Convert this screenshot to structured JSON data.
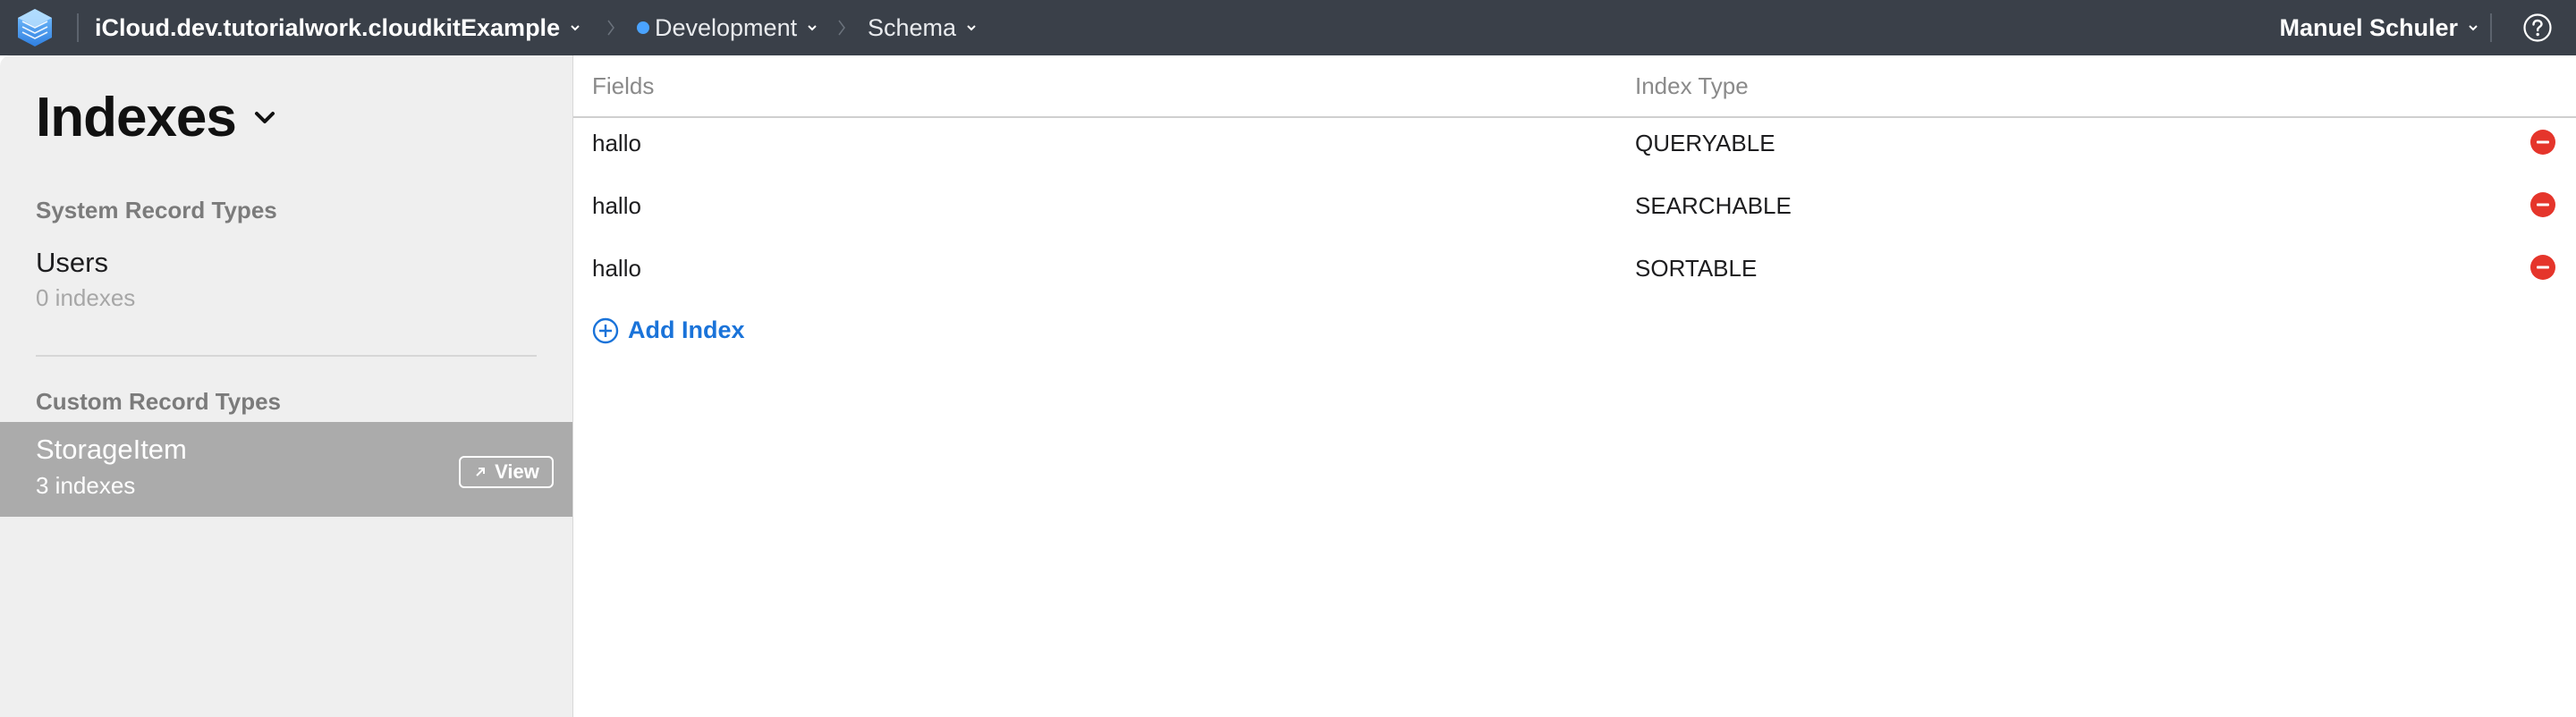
{
  "topbar": {
    "container": "iCloud.dev.tutorialwork.cloudkitExample",
    "environment": "Development",
    "section": "Schema",
    "user": "Manuel Schuler"
  },
  "sidebar": {
    "title": "Indexes",
    "system_heading": "System Record Types",
    "system_types": [
      {
        "name": "Users",
        "count": "0 indexes"
      }
    ],
    "custom_heading": "Custom Record Types",
    "custom_types": [
      {
        "name": "StorageItem",
        "count": "3 indexes",
        "action": "View",
        "selected": true
      }
    ]
  },
  "table": {
    "columns": [
      "Fields",
      "Index Type"
    ],
    "rows": [
      {
        "field": "hallo",
        "type": "QUERYABLE"
      },
      {
        "field": "hallo",
        "type": "SEARCHABLE"
      },
      {
        "field": "hallo",
        "type": "SORTABLE"
      }
    ],
    "add_label": "Add Index"
  },
  "colors": {
    "topbar": "#3a4049",
    "accent": "#1a73d9",
    "remove": "#e5352b",
    "selected": "#ababab"
  }
}
